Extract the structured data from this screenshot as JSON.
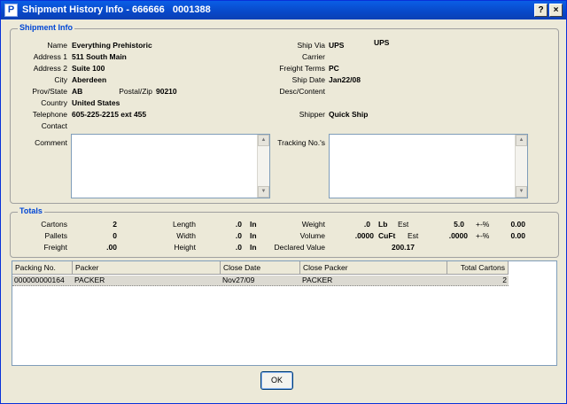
{
  "window": {
    "title": "Shipment History Info - 666666   0001388",
    "app_icon_glyph": "P",
    "help_glyph": "?",
    "close_glyph": "×"
  },
  "shipment_info": {
    "section_title": "Shipment Info",
    "name_label": "Name",
    "name": "Everything Prehistoric",
    "address1_label": "Address 1",
    "address1": "511 South Main",
    "address2_label": "Address 2",
    "address2": "Suite 100",
    "city_label": "City",
    "city": "Aberdeen",
    "prov_label": "Prov/State",
    "prov": "AB",
    "postal_label": "Postal/Zip",
    "postal": "90210",
    "country_label": "Country",
    "country": "United States",
    "telephone_label": "Telephone",
    "telephone": "605-225-2215 ext 455",
    "contact_label": "Contact",
    "contact": "",
    "comment_label": "Comment",
    "comment": "",
    "ship_via_label": "Ship Via",
    "ship_via": "UPS",
    "ship_via_desc": "UPS",
    "carrier_label": "Carrier",
    "carrier": "",
    "freight_terms_label": "Freight Terms",
    "freight_terms": "PC",
    "ship_date_label": "Ship Date",
    "ship_date": "Jan22/08",
    "desc_label": "Desc/Content",
    "desc": "",
    "shipper_label": "Shipper",
    "shipper": "Quick Ship",
    "tracking_label": "Tracking No.'s",
    "tracking": ""
  },
  "totals": {
    "section_title": "Totals",
    "cartons_label": "Cartons",
    "cartons": "2",
    "pallets_label": "Pallets",
    "pallets": "0",
    "freight_label": "Freight",
    "freight": ".00",
    "length_label": "Length",
    "length": ".0",
    "length_unit": "In",
    "width_label": "Width",
    "width": ".0",
    "width_unit": "In",
    "height_label": "Height",
    "height": ".0",
    "height_unit": "In",
    "weight_label": "Weight",
    "weight": ".0",
    "weight_unit": "Lb",
    "weight_est_label": "Est",
    "weight_est": "5.0",
    "weight_pct_label": "+-%",
    "weight_pct": "0.00",
    "volume_label": "Volume",
    "volume": ".0000",
    "volume_unit": "CuFt",
    "volume_est_label": "Est",
    "volume_est": ".0000",
    "volume_pct_label": "+-%",
    "volume_pct": "0.00",
    "declared_label": "Declared Value",
    "declared": "200.17"
  },
  "packing_grid": {
    "columns": [
      "Packing No.",
      "Packer",
      "Close Date",
      "Close Packer",
      "Total Cartons"
    ],
    "rows": [
      {
        "packing_no": "000000000164",
        "packer": "PACKER",
        "close_date": "Nov27/09",
        "close_packer": "PACKER",
        "total_cartons": "2"
      }
    ]
  },
  "buttons": {
    "ok": "OK"
  }
}
